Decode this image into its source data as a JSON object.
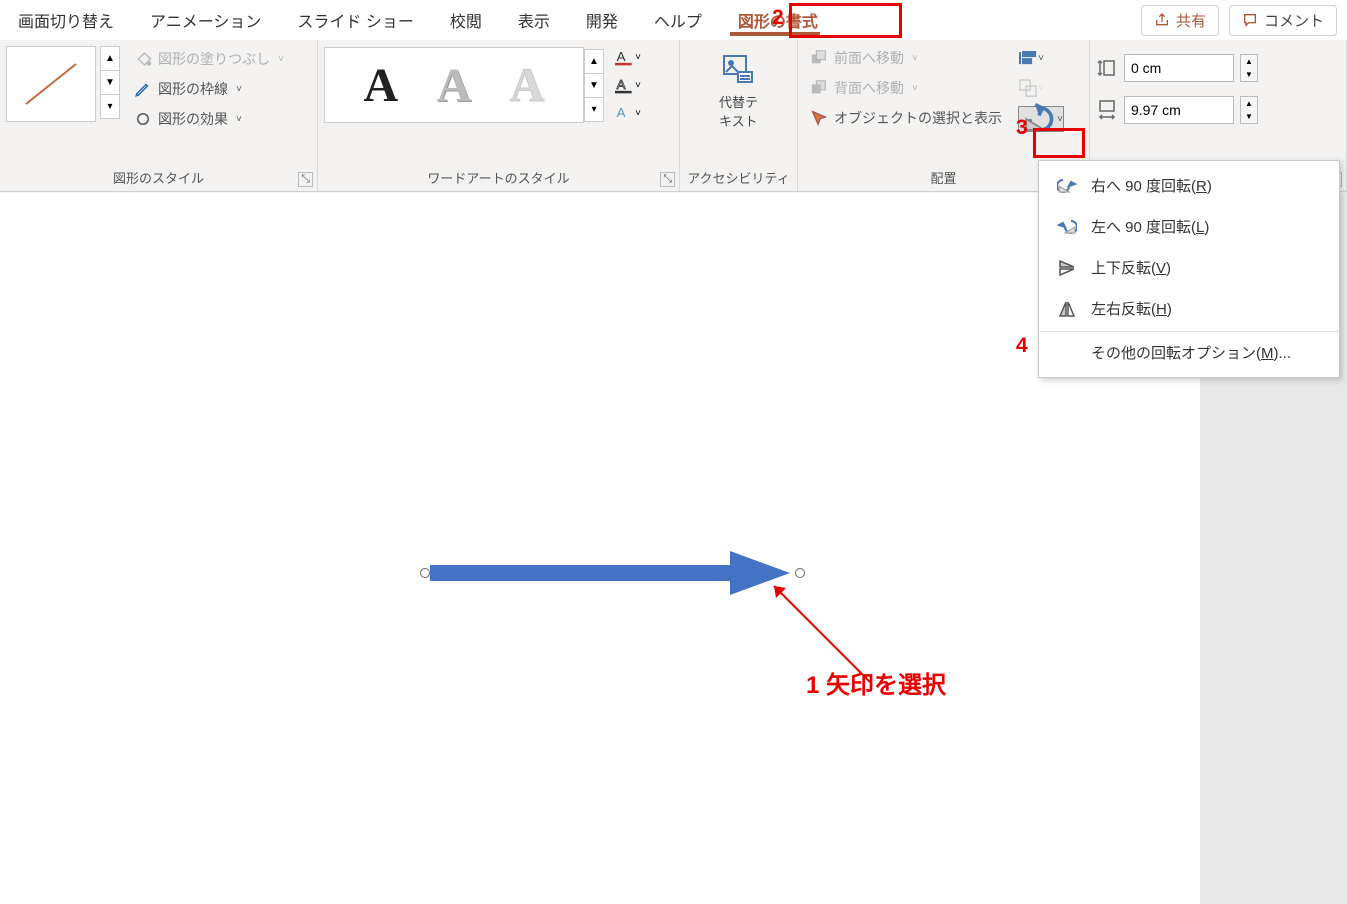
{
  "tabs": {
    "transition": "画面切り替え",
    "animation": "アニメーション",
    "slideshow": "スライド ショー",
    "review": "校閲",
    "view": "表示",
    "developer": "開発",
    "help": "ヘルプ",
    "shape_format": "図形の書式"
  },
  "top_buttons": {
    "share": "共有",
    "comment": "コメント"
  },
  "shape_style": {
    "fill": "図形の塗りつぶし",
    "outline": "図形の枠線",
    "effects": "図形の効果",
    "group_label": "図形のスタイル"
  },
  "wordart": {
    "group_label": "ワードアートのスタイル"
  },
  "alt_text": {
    "line1": "代替テ",
    "line2": "キスト",
    "group_label": "アクセシビリティ"
  },
  "arrange": {
    "bring_forward": "前面へ移動",
    "send_backward": "背面へ移動",
    "selection_pane": "オブジェクトの選択と表示",
    "group_label": "配置"
  },
  "size": {
    "height": "0 cm",
    "width": "9.97 cm"
  },
  "rotate_menu": {
    "right90_pre": "右へ 90 度回転(",
    "right90_u": "R",
    "right90_post": ")",
    "left90_pre": "左へ 90 度回転(",
    "left90_u": "L",
    "left90_post": ")",
    "flipv_pre": "上下反転(",
    "flipv_u": "V",
    "flipv_post": ")",
    "fliph_pre": "左右反転(",
    "fliph_u": "H",
    "fliph_post": ")",
    "more_pre": "その他の回転オプション(",
    "more_u": "M",
    "more_post": ")..."
  },
  "annotations": {
    "n1": "1 矢印を選択",
    "n2": "2",
    "n3": "3",
    "n4": "4"
  }
}
